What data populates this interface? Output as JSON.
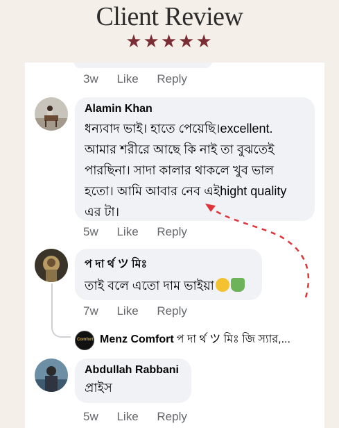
{
  "header": {
    "title": "Client Review",
    "stars": "★★★★★"
  },
  "comments": [
    {
      "meta": {
        "time": "3w",
        "like": "Like",
        "reply": "Reply"
      }
    },
    {
      "author": "Alamin Khan",
      "text_lines": [
        "ধন্যবাদ ভাই। হাতে পেয়েছি।excellent.",
        "আমার শরীরে আছে কি নাই তা বুঝতেই",
        "পারছিনা। সাদা কালার থাকলে খুব ভাল",
        "হতো। আমি আবার নেব এইhight quality",
        "এর টা।"
      ],
      "meta": {
        "time": "5w",
        "like": "Like",
        "reply": "Reply"
      }
    },
    {
      "author": "প দা র্থ ツ মিঃ",
      "text": "তাই বলে এতো দাম ভাইয়া",
      "meta": {
        "time": "7w",
        "like": "Like",
        "reply": "Reply"
      }
    },
    {
      "author": "Abdullah Rabbani",
      "text": "প্রাইস",
      "meta": {
        "time": "5w",
        "like": "Like",
        "reply": "Reply"
      }
    }
  ],
  "reply_preview": {
    "name": "Menz Comfort",
    "text": "প দা র্থ ツ মিঃ জি স্যার,...",
    "avatar_text": "Comfort"
  },
  "colors": {
    "accent": "#7a2d34",
    "arrow": "#e0333a",
    "bubble": "#f0f2f5"
  }
}
